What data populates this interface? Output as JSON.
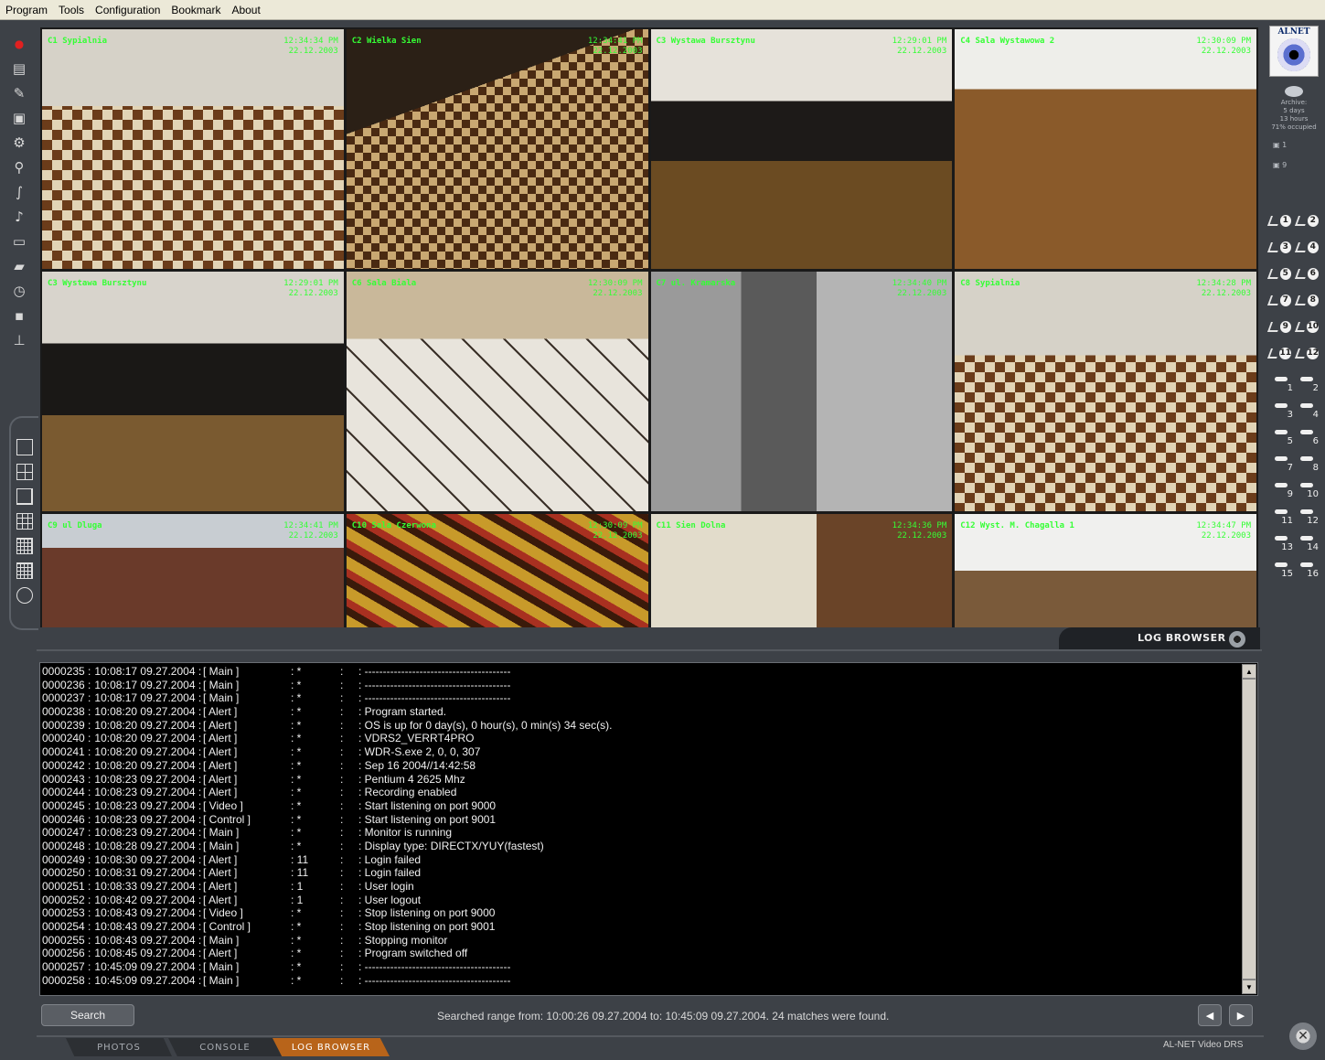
{
  "menu": [
    "Program",
    "Tools",
    "Configuration",
    "Bookmark",
    "About"
  ],
  "left_tools": [
    {
      "name": "record-icon",
      "glyph": "●"
    },
    {
      "name": "film-icon",
      "glyph": "▤"
    },
    {
      "name": "tools-icon",
      "glyph": "✎"
    },
    {
      "name": "camera-icon",
      "glyph": "▣"
    },
    {
      "name": "camera-settings-icon",
      "glyph": "⚙"
    },
    {
      "name": "cameras-icon",
      "glyph": "⚲"
    },
    {
      "name": "cable-icon",
      "glyph": "∫"
    },
    {
      "name": "microphone-icon",
      "glyph": "♪"
    },
    {
      "name": "disk-icon",
      "glyph": "▭"
    },
    {
      "name": "video-camera-icon",
      "glyph": "▰"
    },
    {
      "name": "schedule-icon",
      "glyph": "◷"
    },
    {
      "name": "save-icon",
      "glyph": "▪"
    },
    {
      "name": "network-icon",
      "glyph": "⊥"
    }
  ],
  "layout_buttons": [
    "layout-1x1",
    "layout-2x2",
    "layout-1plus5",
    "layout-3x3",
    "layout-4x4",
    "layout-5x5",
    "layout-sequence"
  ],
  "cameras": [
    {
      "label": "C1 Sypialnia",
      "time": "12:34:34 PM",
      "date": "22.12.2003",
      "scene": "room1"
    },
    {
      "label": "C2 Wielka Sien",
      "time": "12:34:41 PM",
      "date": "22.12.2003",
      "scene": "room2"
    },
    {
      "label": "C3 Wystawa Bursztynu",
      "time": "12:29:01 PM",
      "date": "22.12.2003",
      "scene": "room3"
    },
    {
      "label": "C4 Sala Wystawowa 2",
      "time": "12:30:09 PM",
      "date": "22.12.2003",
      "scene": "room4"
    },
    {
      "label": "C3 Wystawa Bursztynu",
      "time": "12:29:01 PM",
      "date": "22.12.2003",
      "scene": "room5"
    },
    {
      "label": "C6 Sala Biala",
      "time": "12:30:09 PM",
      "date": "22.12.2003",
      "scene": "room6"
    },
    {
      "label": "C7 ul. Kramarska",
      "time": "12:34:40 PM",
      "date": "22.12.2003",
      "scene": "room7"
    },
    {
      "label": "C8 Sypialnia",
      "time": "12:34:28 PM",
      "date": "22.12.2003",
      "scene": "room8"
    },
    {
      "label": "C9 ul Dluga",
      "time": "12:34:41 PM",
      "date": "22.12.2003",
      "scene": "room9"
    },
    {
      "label": "C10 Sala Czerwona",
      "time": "12:30:09 PM",
      "date": "22.12.2003",
      "scene": "room10"
    },
    {
      "label": "C11 Sien Dolna",
      "time": "12:34:36 PM",
      "date": "22.12.2003",
      "scene": "room11"
    },
    {
      "label": "C12 Wyst. M. Chagalla 1",
      "time": "12:34:47 PM",
      "date": "22.12.2003",
      "scene": "room12"
    }
  ],
  "logo": {
    "brand": "ALNET"
  },
  "archive": {
    "line1": "Archive:",
    "line2": "5 days",
    "line3": "13 hours",
    "line4": "71% occupied"
  },
  "mini_labels": [
    "1",
    "9"
  ],
  "ptz_buttons": [
    "1",
    "2",
    "3",
    "4",
    "5",
    "6",
    "7",
    "8",
    "9",
    "10",
    "11",
    "12"
  ],
  "seq_buttons": [
    "1",
    "2",
    "3",
    "4",
    "5",
    "6",
    "7",
    "8",
    "9",
    "10",
    "11",
    "12",
    "13",
    "14",
    "15",
    "16"
  ],
  "log_header": "LOG BROWSER",
  "log": [
    {
      "id": "0000235 :",
      "ts": "10:08:17 09.27.2004 :",
      "mod": "[ Main ]",
      "usr": ": *",
      "c1": ":",
      "msg": ": ----------------------------------------"
    },
    {
      "id": "0000236 :",
      "ts": "10:08:17 09.27.2004 :",
      "mod": "[ Main ]",
      "usr": ": *",
      "c1": ":",
      "msg": ": ----------------------------------------"
    },
    {
      "id": "0000237 :",
      "ts": "10:08:17 09.27.2004 :",
      "mod": "[ Main ]",
      "usr": ": *",
      "c1": ":",
      "msg": ": ----------------------------------------"
    },
    {
      "id": "0000238 :",
      "ts": "10:08:20 09.27.2004 :",
      "mod": "[ Alert ]",
      "usr": ": *",
      "c1": ":",
      "msg": ": Program started."
    },
    {
      "id": "0000239 :",
      "ts": "10:08:20 09.27.2004 :",
      "mod": "[ Alert ]",
      "usr": ": *",
      "c1": ":",
      "msg": ": OS is up for 0 day(s), 0 hour(s), 0 min(s) 34 sec(s)."
    },
    {
      "id": "0000240 :",
      "ts": "10:08:20 09.27.2004 :",
      "mod": "[ Alert ]",
      "usr": ": *",
      "c1": ":",
      "msg": ": VDRS2_VERRT4PRO"
    },
    {
      "id": "0000241 :",
      "ts": "10:08:20 09.27.2004 :",
      "mod": "[ Alert ]",
      "usr": ": *",
      "c1": ":",
      "msg": ": WDR-S.exe 2, 0, 0, 307"
    },
    {
      "id": "0000242 :",
      "ts": "10:08:20 09.27.2004 :",
      "mod": "[ Alert ]",
      "usr": ": *",
      "c1": ":",
      "msg": ": Sep 16 2004//14:42:58"
    },
    {
      "id": "0000243 :",
      "ts": "10:08:23 09.27.2004 :",
      "mod": "[ Alert ]",
      "usr": ": *",
      "c1": ":",
      "msg": ": Pentium 4 2625 Mhz"
    },
    {
      "id": "0000244 :",
      "ts": "10:08:23 09.27.2004 :",
      "mod": "[ Alert ]",
      "usr": ": *",
      "c1": ":",
      "msg": ": Recording enabled"
    },
    {
      "id": "0000245 :",
      "ts": "10:08:23 09.27.2004 :",
      "mod": "[ Video ]",
      "usr": ": *",
      "c1": ":",
      "msg": ": Start listening on port 9000"
    },
    {
      "id": "0000246 :",
      "ts": "10:08:23 09.27.2004 :",
      "mod": "[ Control ]",
      "usr": ": *",
      "c1": ":",
      "msg": ": Start listening on port 9001"
    },
    {
      "id": "0000247 :",
      "ts": "10:08:23 09.27.2004 :",
      "mod": "[ Main ]",
      "usr": ": *",
      "c1": ":",
      "msg": ": Monitor is running"
    },
    {
      "id": "0000248 :",
      "ts": "10:08:28 09.27.2004 :",
      "mod": "[ Main ]",
      "usr": ": *",
      "c1": ":",
      "msg": ": Display type: DIRECTX/YUY(fastest)"
    },
    {
      "id": "0000249 :",
      "ts": "10:08:30 09.27.2004 :",
      "mod": "[ Alert ]",
      "usr": ": 11",
      "c1": ":",
      "msg": ": Login failed"
    },
    {
      "id": "0000250 :",
      "ts": "10:08:31 09.27.2004 :",
      "mod": "[ Alert ]",
      "usr": ": 11",
      "c1": ":",
      "msg": ": Login failed"
    },
    {
      "id": "0000251 :",
      "ts": "10:08:33 09.27.2004 :",
      "mod": "[ Alert ]",
      "usr": ": 1",
      "c1": ":",
      "msg": ": User login"
    },
    {
      "id": "0000252 :",
      "ts": "10:08:42 09.27.2004 :",
      "mod": "[ Alert ]",
      "usr": ": 1",
      "c1": ":",
      "msg": ": User logout"
    },
    {
      "id": "0000253 :",
      "ts": "10:08:43 09.27.2004 :",
      "mod": "[ Video ]",
      "usr": ": *",
      "c1": ":",
      "msg": ": Stop listening on port 9000"
    },
    {
      "id": "0000254 :",
      "ts": "10:08:43 09.27.2004 :",
      "mod": "[ Control ]",
      "usr": ": *",
      "c1": ":",
      "msg": ": Stop listening on port 9001"
    },
    {
      "id": "0000255 :",
      "ts": "10:08:43 09.27.2004 :",
      "mod": "[ Main ]",
      "usr": ": *",
      "c1": ":",
      "msg": ": Stopping monitor"
    },
    {
      "id": "0000256 :",
      "ts": "10:08:45 09.27.2004 :",
      "mod": "[ Alert ]",
      "usr": ": *",
      "c1": ":",
      "msg": ": Program switched off"
    },
    {
      "id": "0000257 :",
      "ts": "10:45:09 09.27.2004 :",
      "mod": "[ Main ]",
      "usr": ": *",
      "c1": ":",
      "msg": ": ----------------------------------------"
    },
    {
      "id": "0000258 :",
      "ts": "10:45:09 09.27.2004 :",
      "mod": "[ Main ]",
      "usr": ": *",
      "c1": ":",
      "msg": ": ----------------------------------------"
    }
  ],
  "search_button": "Search",
  "status": "Searched range from: 10:00:26 09.27.2004 to: 10:45:09 09.27.2004.   24 matches were found.",
  "nav": {
    "prev": "◀",
    "next": "▶"
  },
  "tabs": [
    {
      "label": "PHOTOS",
      "active": false
    },
    {
      "label": "CONSOLE",
      "active": false
    },
    {
      "label": "LOG BROWSER",
      "active": true
    }
  ],
  "product": "AL-NET Video DRS",
  "colors": {
    "accent": "#b8641a",
    "overlay": "#35ff35",
    "background": "#3d4147"
  }
}
